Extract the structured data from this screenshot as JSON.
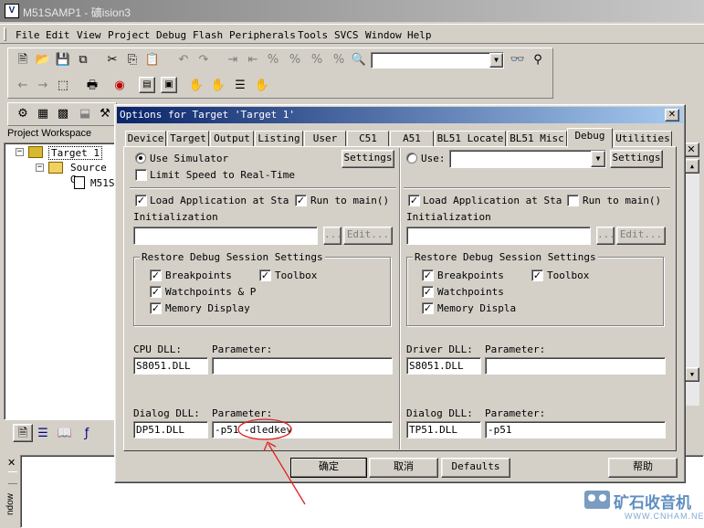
{
  "app": {
    "title": "M51SAMP1 - 礦ision3"
  },
  "menu": [
    "File",
    "Edit",
    "View",
    "Project",
    "Debug",
    "Flash",
    "Peripherals",
    "Tools",
    "SVCS",
    "Window",
    "Help"
  ],
  "workspace": {
    "title": "Project Workspace",
    "tree": [
      "Target 1",
      "Source G",
      "M51S"
    ],
    "bottom_label": "ndow"
  },
  "dialog": {
    "title": "Options for Target 'Target 1'",
    "tabs": [
      "Device",
      "Target",
      "Output",
      "Listing",
      "User",
      "C51",
      "A51",
      "BL51 Locate",
      "BL51 Misc",
      "Debug",
      "Utilities"
    ],
    "active_tab": "Debug",
    "left": {
      "use_simulator": "Use Simulator",
      "limit_speed": "Limit Speed to Real-Time",
      "settings": "Settings",
      "load_app": "Load Application at Sta",
      "run_main": "Run to main()",
      "init_label": "Initialization",
      "init_value": "",
      "browse": "...",
      "edit": "Edit...",
      "restore_title": "Restore Debug Session Settings",
      "breakpoints": "Breakpoints",
      "toolbox": "Toolbox",
      "watchpoints": "Watchpoints & P",
      "memory": "Memory Display",
      "cpu_dll_label": "CPU DLL:",
      "param_label": "Parameter:",
      "cpu_dll": "S8051.DLL",
      "cpu_param": "",
      "dialog_dll_label": "Dialog DLL:",
      "dialog_dll": "DP51.DLL",
      "dialog_param_prefix": "-p51",
      "dialog_param_highlight": "-dledkey"
    },
    "right": {
      "use": "Use:",
      "use_value": "",
      "settings": "Settings",
      "load_app": "Load Application at Sta",
      "run_main": "Run to main()",
      "init_label": "Initialization",
      "init_value": "",
      "browse": "...",
      "edit": "Edit...",
      "restore_title": "Restore Debug Session Settings",
      "breakpoints": "Breakpoints",
      "toolbox": "Toolbox",
      "watchpoints": "Watchpoints",
      "memory": "Memory Displa",
      "driver_dll_label": "Driver DLL:",
      "param_label": "Parameter:",
      "driver_dll": "S8051.DLL",
      "driver_param": "",
      "dialog_dll_label": "Dialog DLL:",
      "dialog_dll": "TP51.DLL",
      "dialog_param": "-p51"
    },
    "buttons": {
      "ok": "确定",
      "cancel": "取消",
      "defaults": "Defaults",
      "help": "帮助"
    }
  },
  "watermark": {
    "main": "矿石收音机",
    "sub": "WWW.CNHAM.NET"
  },
  "colors": {
    "title_active": "#0a246a",
    "face": "#d4d0c8",
    "annotation": "#e02020"
  }
}
